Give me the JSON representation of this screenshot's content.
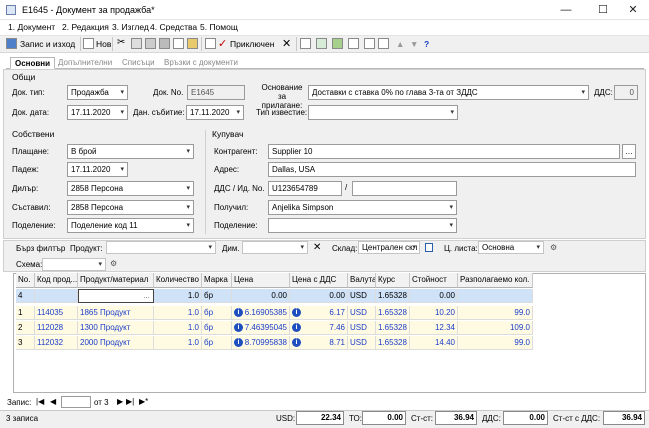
{
  "window": {
    "title": "E1645 - Документ за продажба*",
    "minimize": "—",
    "maximize": "☐",
    "close": "✕"
  },
  "menu": [
    "1. Документ",
    "2. Редакция",
    "3. Изглед",
    "4. Средства",
    "5. Помощ"
  ],
  "toolbar": {
    "save_exit": "Запис и изход",
    "new": "Нов",
    "approved": "Приключен"
  },
  "tabs": [
    "Основни",
    "Допълнителни",
    "Списъци",
    "Връзки с документи"
  ],
  "general": {
    "section": "Общи",
    "doc_type_label": "Док. тип:",
    "doc_type": "Продажба",
    "doc_no_label": "Док. No.",
    "doc_no": "E1645",
    "basis_label": "Основание за прилагане:",
    "basis": "Доставки с ставка 0% по глава 3-та от ЗДДС",
    "vat_label": "ДДС:",
    "vat": "0",
    "doc_date_label": "Док. дата:",
    "doc_date": "17.11.2020",
    "event_date_label": "Дан. събитие:",
    "event_date": "17.11.2020",
    "notice_type_label": "Тип известие:",
    "notice_type": ""
  },
  "own": {
    "section": "Собствени",
    "payment_label": "Плащане:",
    "payment": "В брой",
    "due_label": "Падеж:",
    "due": "17.11.2020",
    "dealer_label": "Дилър:",
    "dealer": "2858 Персона",
    "author_label": "Съставил:",
    "author": "2858 Персона",
    "division_label": "Поделение:",
    "division": "Поделение код 11"
  },
  "buyer": {
    "section": "Купувач",
    "partner_label": "Контрагент:",
    "partner": "Supplier 10",
    "address_label": "Адрес:",
    "address": "Dallas, USA",
    "vatid_label": "ДДС / Ид. No.",
    "vatid": "U123654789",
    "idno": "",
    "receiver_label": "Получил:",
    "receiver": "Anjelika Simpson",
    "division_label": "Поделение:",
    "division": ""
  },
  "filter": {
    "quick": "Бърз филтър",
    "product_label": "Продукт:",
    "product": "",
    "dim_label": "Дим.",
    "dim": "",
    "warehouse_label": "Склад:",
    "warehouse": "Централен скл",
    "pricelist_label": "Ц. листа:",
    "pricelist": "Основна",
    "scheme_label": "Схема:",
    "scheme": ""
  },
  "grid": {
    "headers": [
      "No.",
      "Код прод...",
      "Продукт/материал",
      "Количество",
      "Марка",
      "Цена",
      "Цена с ДДС",
      "Валута",
      "Курс",
      "Стойност",
      "Разполагаемо кол."
    ],
    "new_row": {
      "no": "4",
      "code": "",
      "name": "",
      "qty": "1.0",
      "unit": "бр",
      "price": "0.00",
      "price_vat": "0.00",
      "cur": "USD",
      "rate": "1.65328",
      "value": "0.00",
      "avail": ""
    },
    "rows": [
      {
        "no": "1",
        "code": "114035",
        "name": "1865 Продукт",
        "qty": "1.0",
        "unit": "бр",
        "price": "6.16905385",
        "price_vat": "6.17",
        "cur": "USD",
        "rate": "1.65328",
        "value": "10.20",
        "avail": "99.0"
      },
      {
        "no": "2",
        "code": "112028",
        "name": "1300 Продукт",
        "qty": "1.0",
        "unit": "бр",
        "price": "7.46395045",
        "price_vat": "7.46",
        "cur": "USD",
        "rate": "1.65328",
        "value": "12.34",
        "avail": "109.0"
      },
      {
        "no": "3",
        "code": "112032",
        "name": "2000 Продукт",
        "qty": "1.0",
        "unit": "бр",
        "price": "8.70995838",
        "price_vat": "8.71",
        "cur": "USD",
        "rate": "1.65328",
        "value": "14.40",
        "avail": "99.0"
      }
    ]
  },
  "nav": {
    "label": "Запис:",
    "current": "",
    "of": "от 3"
  },
  "status": {
    "records": "3 записа",
    "usd_label": "USD:",
    "usd": "22.34",
    "to_label": "ТО:",
    "to": "0.00",
    "value_label": "Ст-ст:",
    "value": "36.94",
    "vat_label": "ДДС:",
    "vat": "0.00",
    "total_label": "Ст-ст с ДДС:",
    "total": "36.94"
  }
}
